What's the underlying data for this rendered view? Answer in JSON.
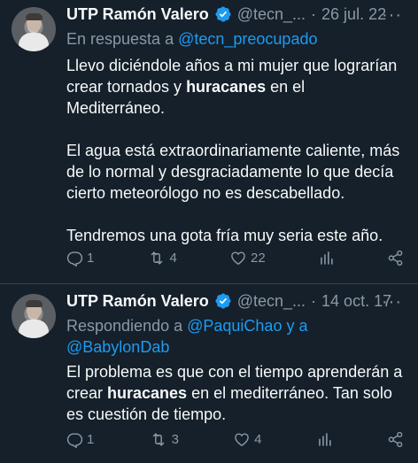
{
  "tweets": [
    {
      "name": "UTP Ramón Valero",
      "handle": "@tecn_...",
      "date": "26 jul. 22",
      "reply_prefix": "En respuesta a ",
      "reply_target": "@tecn_preocupado",
      "p1a": "Llevo diciéndole años a mi mujer que lograrían crear tornados y ",
      "p1b": "huracanes",
      "p1c": " en el Mediterráneo.",
      "p2": "El agua está extraordinariamente caliente, más de lo normal y desgraciadamente lo que decía cierto meteorólogo no es descabellado.",
      "p3": "Tendremos una gota fría muy seria este año.",
      "replies": "1",
      "retweets": "4",
      "likes": "22"
    },
    {
      "name": "UTP Ramón Valero",
      "handle": "@tecn_...",
      "date": "14 oct. 17",
      "reply_prefix": "Respondiendo a ",
      "reply_target1": "@PaquiChao",
      "reply_and": " y a",
      "reply_target2": "@BabylonDab",
      "p1a": "El problema es que con el tiempo aprenderán a crear ",
      "p1b": "huracanes",
      "p1c": " en el mediterráneo. Tan solo es cuestión de tiempo.",
      "replies": "1",
      "retweets": "3",
      "likes": "4"
    }
  ],
  "separator": "·",
  "more": "···",
  "colors": {
    "background": "#15202b",
    "text": "#f7f9f9",
    "muted": "#8b98a5",
    "link": "#1d9bf0",
    "verified": "#1d9bf0"
  }
}
